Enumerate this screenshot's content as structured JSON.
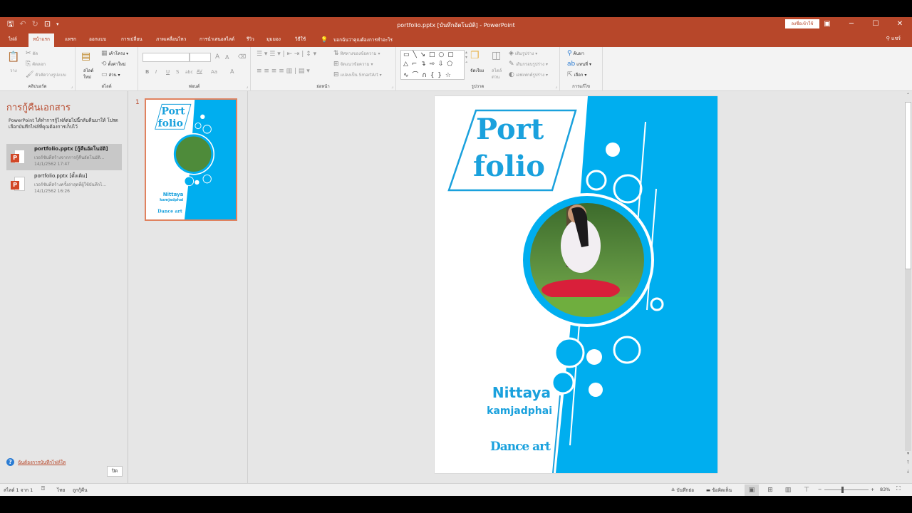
{
  "window": {
    "title": "portfolio.pptx [บันทึกอัตโนมัติ] - PowerPoint",
    "signin_label": "ลงชื่อเข้าใช้",
    "share_label": "แชร์"
  },
  "quick_access": {
    "save_icon": "save-icon",
    "undo_icon": "undo-icon",
    "redo_icon": "redo-icon",
    "present_icon": "start-from-beginning-icon"
  },
  "tabs": [
    {
      "label": "ไฟล์",
      "active": false
    },
    {
      "label": "หน้าแรก",
      "active": true
    },
    {
      "label": "แทรก",
      "active": false
    },
    {
      "label": "ออกแบบ",
      "active": false
    },
    {
      "label": "การเปลี่ยน",
      "active": false
    },
    {
      "label": "ภาพเคลื่อนไหว",
      "active": false
    },
    {
      "label": "การนำเสนอสไลด์",
      "active": false
    },
    {
      "label": "รีวิว",
      "active": false
    },
    {
      "label": "มุมมอง",
      "active": false
    },
    {
      "label": "วิธีใช้",
      "active": false
    }
  ],
  "tell_me": "บอกฉันว่าคุณต้องการทำอะไร",
  "ribbon": {
    "clipboard": {
      "label": "คลิปบอร์ด",
      "paste": "วาง",
      "cut": "ตัด",
      "copy": "คัดลอก",
      "format_painter": "ตัวคัดวางรูปแบบ"
    },
    "slides": {
      "label": "สไลด์",
      "new_slide": "สไลด์",
      "new_slide_2": "ใหม่",
      "layout": "เค้าโครง",
      "reset": "ตั้งค่าใหม่",
      "section": "ส่วน"
    },
    "font": {
      "label": "ฟอนต์",
      "font_name": "",
      "font_size": "",
      "bold": "B",
      "italic": "I",
      "underline": "U",
      "shadow": "S",
      "strike": "abc",
      "spacing": "AV",
      "case": "Aa",
      "color": "A",
      "grow": "A",
      "shrink": "A"
    },
    "paragraph": {
      "label": "ย่อหน้า",
      "text_direction": "ทิศทางของข้อความ",
      "align_text": "จัดแนวข้อความ",
      "smartart": "แปลงเป็น SmartArt"
    },
    "drawing": {
      "label": "รูปวาด",
      "arrange": "จัดเรียง",
      "quick_styles": "สไตล์",
      "quick_styles_2": "ด่วน",
      "shape_fill": "เติมรูปร่าง",
      "shape_outline": "เส้นกรอบรูปร่าง",
      "shape_effects": "เอฟเฟกต์รูปร่าง"
    },
    "editing": {
      "label": "การแก้ไข",
      "find": "ค้นหา",
      "replace": "แทนที่",
      "select": "เลือก"
    }
  },
  "recovery": {
    "title": "การกู้คืนเอกสาร",
    "description": "PowerPoint ได้ทำการกู้ไฟล์ต่อไปนี้กลับคืนมาให้ โปรดเลือกบันทึกไฟล์ที่คุณต้องการเก็บไว้",
    "items": [
      {
        "name": "portfolio.pptx  [กู้คืนอัตโนมัติ]",
        "subtitle": "เวอร์ชันที่สร้างจากการกู้คืนอัตโนมัติ...",
        "date": "14/1/2562 17:47",
        "selected": true
      },
      {
        "name": "portfolio.pptx  [ดั้งเดิม]",
        "subtitle": "เวอร์ชันที่สร้างครั้งล่าสุดที่ผู้ใช้บันทึกไ...",
        "date": "14/1/2562 16:26",
        "selected": false
      }
    ],
    "help_link": "ฉันต้องการบันทึกไฟล์ใด",
    "close_label": "ปิด"
  },
  "thumbnails": [
    {
      "number": "1",
      "selected": true
    }
  ],
  "slide": {
    "title_line1": "Port",
    "title_line2": "folio",
    "name_first": "Nittaya",
    "name_last": "kamjadphai",
    "subject": "Dance art",
    "colors": {
      "accent": "#00aeef",
      "text": "#1aa1dd",
      "background": "#ffffff"
    }
  },
  "statusbar": {
    "slide_info": "สไลด์ 1 จาก 1",
    "language": "ไทย",
    "accessibility": "ถูกกู้คืน",
    "notes": "บันทึกย่อ",
    "comments": "ข้อคิดเห็น",
    "zoom_level": "83%",
    "zoom_value": 83
  },
  "colors": {
    "brand": "#b7472a",
    "ribbon_bg": "#f3f3f3",
    "workspace_bg": "#e6e6e6"
  }
}
